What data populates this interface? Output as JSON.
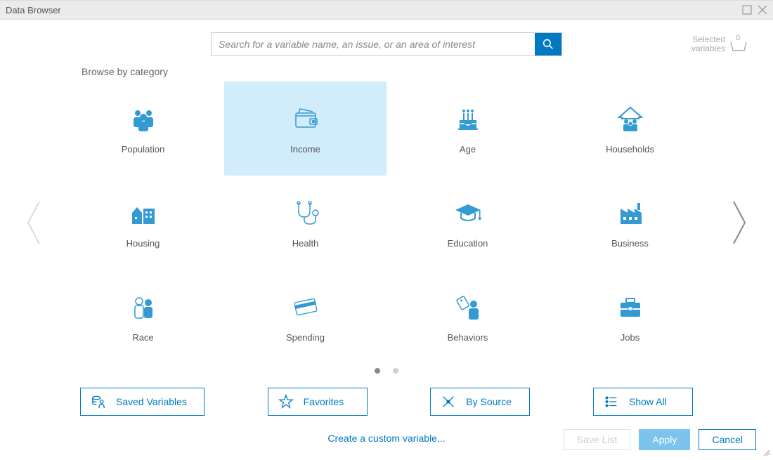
{
  "window": {
    "title": "Data Browser"
  },
  "search": {
    "placeholder": "Search for a variable name, an issue, or an area of interest"
  },
  "selected": {
    "line1": "Selected",
    "line2": "variables",
    "count": "0"
  },
  "browse_label": "Browse by category",
  "categories": {
    "r0c0": "Population",
    "r0c1": "Income",
    "r0c2": "Age",
    "r0c3": "Households",
    "r1c0": "Housing",
    "r1c1": "Health",
    "r1c2": "Education",
    "r1c3": "Business",
    "r2c0": "Race",
    "r2c1": "Spending",
    "r2c2": "Behaviors",
    "r2c3": "Jobs"
  },
  "quick": {
    "saved": "Saved Variables",
    "favorites": "Favorites",
    "source": "By Source",
    "showall": "Show All"
  },
  "custom_link": "Create a custom variable...",
  "footer": {
    "save": "Save List",
    "apply": "Apply",
    "cancel": "Cancel"
  }
}
